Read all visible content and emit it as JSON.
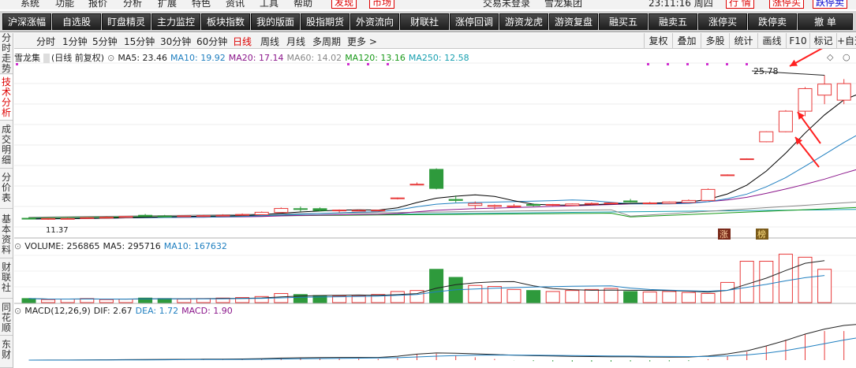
{
  "menubar": {
    "items": [
      "系统",
      "功能",
      "报价",
      "分析",
      "扩展",
      "特色",
      "资讯",
      "工具",
      "帮助"
    ],
    "links": [
      "发现",
      "市场"
    ],
    "status": "交易未登录",
    "stock_name": "雪龙集团",
    "time": "23:11:16 周四",
    "right_buttons": [
      "行 情",
      "涨停买",
      "跌停卖"
    ]
  },
  "toolbar": {
    "buttons": [
      "沪深涨幅",
      "自选股",
      "盯盘精灵",
      "主力监控",
      "板块指数",
      "我的版面",
      "股指期货",
      "外资流向",
      "财联社",
      "涨停回调",
      "游资龙虎",
      "游资复盘",
      "融买五",
      "融卖五",
      "涨停买",
      "跌停卖",
      "撤 单"
    ]
  },
  "leftnav": {
    "items": [
      "分时走势",
      "技术分析",
      "成交明细",
      "分价表",
      "基本资料",
      "财联社",
      "同花顺",
      "东财"
    ]
  },
  "periodbar": {
    "tabs": [
      "分时",
      "1分钟",
      "5分钟",
      "15分钟",
      "30分钟",
      "60分钟",
      "日线",
      "周线",
      "月线",
      "多周期",
      "更多 >"
    ],
    "right_buttons": [
      "复权",
      "叠加",
      "多股",
      "统计",
      "画线",
      "F10",
      "标记",
      "+自选"
    ]
  },
  "main_info": {
    "title": "雪龙集",
    "subtitle": "(日线 前复权)",
    "ma5": "MA5: 23.46",
    "ma10": "MA10: 19.92",
    "ma20": "MA20: 17.14",
    "ma60": "MA60: 14.02",
    "ma120": "MA120: 13.16",
    "ma250": "MA250: 12.58"
  },
  "volume_info": {
    "label": "VOLUME: 256865",
    "ma5": "MA5: 295716",
    "ma10": "MA10: 167632"
  },
  "macd_info": {
    "label": "MACD(12,26,9)",
    "dif": "DIF: 2.67",
    "dea": "DEA: 1.72",
    "macd": "MACD: 1.90"
  },
  "markers": {
    "high": "25.78",
    "low": "11.37",
    "zhang": "涨",
    "lian": "榜"
  },
  "colors": {
    "up": "#e83a3a",
    "down": "#2e9a3c",
    "ma5": "#000000",
    "ma10": "#1f7fc0",
    "ma20": "#8b168b",
    "ma60": "#888888",
    "ma120": "#1a9a1a",
    "ma250": "#18a0b0",
    "arrow": "#ff2020"
  },
  "chart_data": {
    "type": "candlestick",
    "candles": [
      {
        "o": 11.52,
        "h": 11.62,
        "l": 11.4,
        "c": 11.45
      },
      {
        "o": 11.42,
        "h": 11.55,
        "l": 11.37,
        "c": 11.5
      },
      {
        "o": 11.48,
        "h": 11.58,
        "l": 11.44,
        "c": 11.5
      },
      {
        "o": 11.5,
        "h": 11.64,
        "l": 11.46,
        "c": 11.58
      },
      {
        "o": 11.57,
        "h": 11.72,
        "l": 11.52,
        "c": 11.62
      },
      {
        "o": 11.6,
        "h": 11.76,
        "l": 11.56,
        "c": 11.7
      },
      {
        "o": 11.82,
        "h": 11.95,
        "l": 11.64,
        "c": 11.7
      },
      {
        "o": 11.74,
        "h": 11.86,
        "l": 11.62,
        "c": 11.72
      },
      {
        "o": 11.7,
        "h": 11.8,
        "l": 11.64,
        "c": 11.76
      },
      {
        "o": 11.76,
        "h": 11.86,
        "l": 11.7,
        "c": 11.78
      },
      {
        "o": 11.78,
        "h": 11.92,
        "l": 11.72,
        "c": 11.82
      },
      {
        "o": 11.82,
        "h": 12.0,
        "l": 11.78,
        "c": 11.9
      },
      {
        "o": 11.88,
        "h": 12.2,
        "l": 11.84,
        "c": 12.12
      },
      {
        "o": 12.1,
        "h": 12.6,
        "l": 12.06,
        "c": 12.5
      },
      {
        "o": 12.48,
        "h": 12.7,
        "l": 12.2,
        "c": 12.4
      },
      {
        "o": 12.48,
        "h": 12.6,
        "l": 12.2,
        "c": 12.3
      },
      {
        "o": 12.3,
        "h": 12.4,
        "l": 12.1,
        "c": 12.34
      },
      {
        "o": 12.3,
        "h": 12.38,
        "l": 12.28,
        "c": 12.32
      },
      {
        "o": 12.3,
        "h": 12.36,
        "l": 12.28,
        "c": 12.33
      },
      {
        "o": 13.5,
        "h": 13.6,
        "l": 13.4,
        "c": 13.55
      },
      {
        "o": 14.9,
        "h": 15.1,
        "l": 14.85,
        "c": 14.92
      },
      {
        "o": 16.4,
        "h": 16.5,
        "l": 14.4,
        "c": 14.5
      },
      {
        "o": 13.4,
        "h": 13.8,
        "l": 13.1,
        "c": 13.3
      },
      {
        "o": 12.8,
        "h": 13.2,
        "l": 12.4,
        "c": 13.0
      },
      {
        "o": 12.7,
        "h": 12.9,
        "l": 12.4,
        "c": 12.8
      },
      {
        "o": 12.7,
        "h": 12.95,
        "l": 12.55,
        "c": 12.75
      },
      {
        "o": 12.9,
        "h": 13.0,
        "l": 12.7,
        "c": 12.8
      },
      {
        "o": 12.85,
        "h": 12.95,
        "l": 12.75,
        "c": 12.9
      },
      {
        "o": 12.8,
        "h": 13.0,
        "l": 12.75,
        "c": 12.95
      },
      {
        "o": 12.95,
        "h": 13.1,
        "l": 12.85,
        "c": 13.0
      },
      {
        "o": 13.0,
        "h": 13.1,
        "l": 12.95,
        "c": 13.05
      },
      {
        "o": 13.25,
        "h": 13.45,
        "l": 13.1,
        "c": 13.15
      },
      {
        "o": 13.05,
        "h": 13.15,
        "l": 12.95,
        "c": 13.05
      },
      {
        "o": 13.0,
        "h": 13.2,
        "l": 12.95,
        "c": 13.15
      },
      {
        "o": 13.1,
        "h": 13.4,
        "l": 13.05,
        "c": 13.3
      },
      {
        "o": 13.3,
        "h": 14.5,
        "l": 13.25,
        "c": 14.4
      },
      {
        "o": 15.8,
        "h": 15.9,
        "l": 15.75,
        "c": 15.85
      },
      {
        "o": 17.4,
        "h": 17.5,
        "l": 17.35,
        "c": 17.45
      },
      {
        "o": 19.15,
        "h": 20.2,
        "l": 19.1,
        "c": 20.15
      },
      {
        "o": 20.15,
        "h": 22.3,
        "l": 20.1,
        "c": 22.2
      },
      {
        "o": 22.2,
        "h": 24.6,
        "l": 21.7,
        "c": 24.45
      },
      {
        "o": 23.8,
        "h": 25.78,
        "l": 22.9,
        "c": 24.9
      },
      {
        "o": 23.3,
        "h": 25.4,
        "l": 22.9,
        "c": 24.95
      },
      {
        "o": 23.8,
        "h": 24.4,
        "l": 22.6,
        "c": 24.05
      }
    ],
    "volume": [
      8,
      6,
      7,
      8,
      6,
      7,
      9,
      8,
      7,
      8,
      9,
      10,
      12,
      18,
      16,
      14,
      13,
      14,
      16,
      22,
      24,
      66,
      50,
      34,
      32,
      26,
      24,
      22,
      24,
      26,
      28,
      22,
      21,
      22,
      20,
      18,
      40,
      82,
      82,
      96,
      90,
      66
    ],
    "price_ylim": [
      10.5,
      27.0
    ],
    "volume_ylim": [
      0,
      100
    ]
  }
}
